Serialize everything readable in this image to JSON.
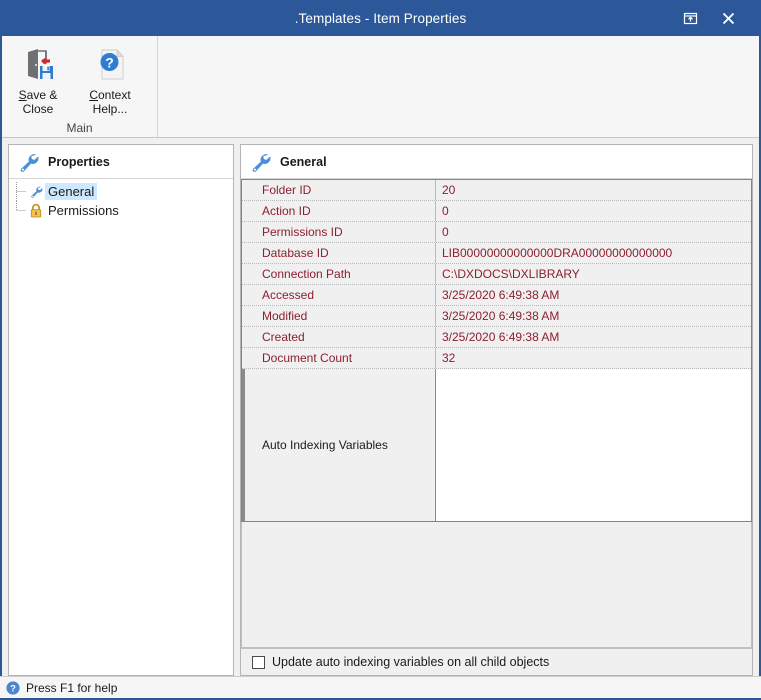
{
  "window": {
    "title": ".Templates - Item Properties",
    "titlebar_color": "#2c5899",
    "buttons": [
      {
        "name": "restore-window-button",
        "icon": "restore-up-icon"
      },
      {
        "name": "close-window-button",
        "icon": "close-icon"
      }
    ]
  },
  "ribbon": {
    "group_title": "Main",
    "buttons": [
      {
        "name": "save-and-close-button",
        "icon": "save-and-close-icon",
        "label_line1": "Save &",
        "label_line2": "Close",
        "accel": "S"
      },
      {
        "name": "context-help-button",
        "icon": "context-help-icon",
        "label_line1": "Context",
        "label_line2": "Help...",
        "accel": "C"
      }
    ]
  },
  "tree": {
    "header": {
      "label": "Properties",
      "icon": "wrench-icon"
    },
    "items": [
      {
        "label": "General",
        "icon": "wrench-icon",
        "selected": true
      },
      {
        "label": "Permissions",
        "icon": "padlock-icon",
        "selected": false
      }
    ]
  },
  "properties": {
    "header": {
      "label": "General",
      "icon": "wrench-icon"
    },
    "rows": [
      {
        "name": "Folder ID",
        "value": "20"
      },
      {
        "name": "Action ID",
        "value": "0"
      },
      {
        "name": "Permissions ID",
        "value": "0"
      },
      {
        "name": "Database ID",
        "value": "LIB00000000000000DRA00000000000000"
      },
      {
        "name": "Connection Path",
        "value": "C:\\DXDOCS\\DXLIBRARY"
      },
      {
        "name": "Accessed",
        "value": "3/25/2020 6:49:38 AM"
      },
      {
        "name": "Modified",
        "value": "3/25/2020 6:49:38 AM"
      },
      {
        "name": "Created",
        "value": "3/25/2020 6:49:38 AM"
      },
      {
        "name": "Document Count",
        "value": "32"
      }
    ],
    "multiline_row": {
      "name": "Auto Indexing Variables",
      "value": ""
    },
    "label_color": "#8c1f2f"
  },
  "checkbox": {
    "label": "Update auto indexing variables on all child objects",
    "checked": false
  },
  "statusbar": {
    "icon": "help-circle-icon",
    "text": "Press F1 for help"
  }
}
